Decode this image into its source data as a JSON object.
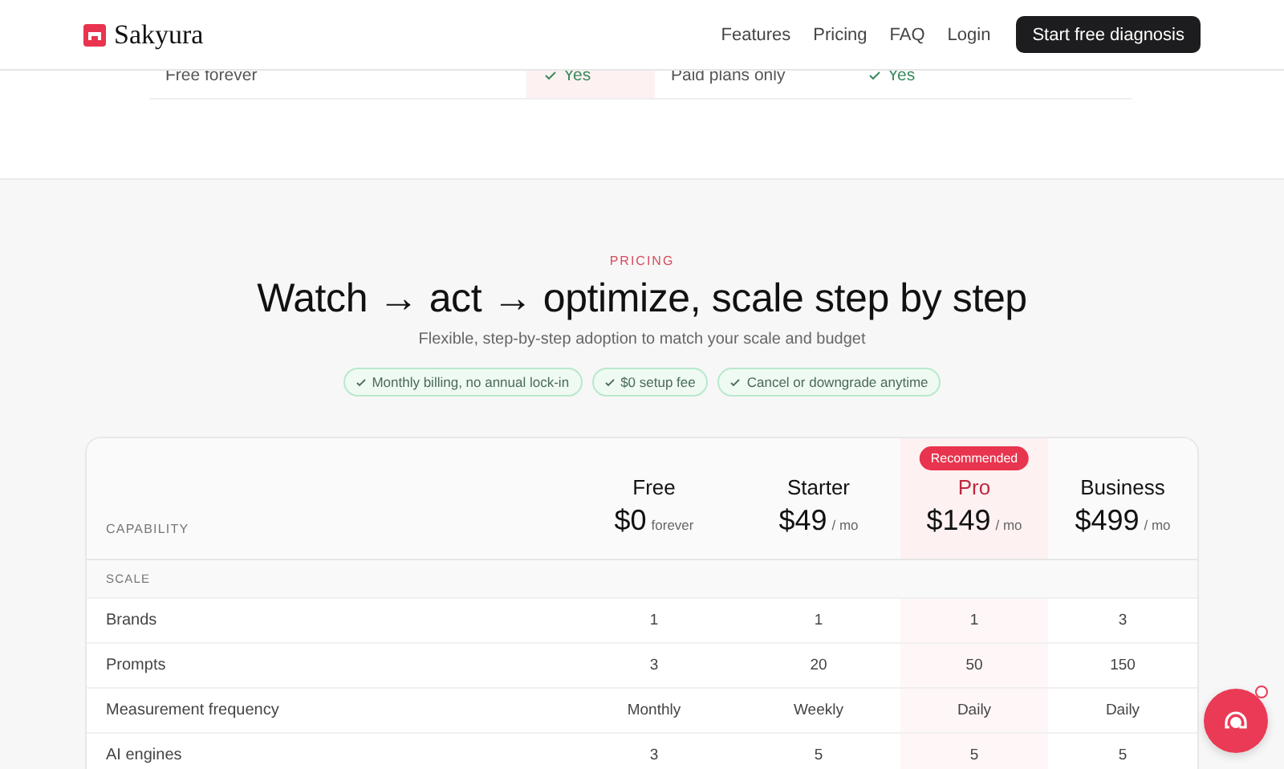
{
  "header": {
    "brand": "Sakyura",
    "nav": [
      "Features",
      "Pricing",
      "FAQ",
      "Login"
    ],
    "cta": "Start free diagnosis"
  },
  "comparison_row": {
    "cells": [
      {
        "text": "Free forever",
        "kind": "text",
        "highlighted": false
      },
      {
        "text": "Yes",
        "kind": "yes",
        "highlighted": true
      },
      {
        "text": "Paid plans only",
        "kind": "text",
        "highlighted": false
      },
      {
        "text": "Yes",
        "kind": "yes",
        "highlighted": false
      }
    ]
  },
  "pricing": {
    "eyebrow": "PRICING",
    "title": "Watch → act → optimize, scale step by step",
    "subtitle": "Flexible, step-by-step adoption to match your scale and budget",
    "chips": [
      "Monthly billing, no annual lock-in",
      "$0 setup fee",
      "Cancel or downgrade anytime"
    ],
    "table": {
      "capability_heading": "CAPABILITY",
      "plans": [
        {
          "name": "Free",
          "price": "$0",
          "period": "forever",
          "selected": false
        },
        {
          "name": "Starter",
          "price": "$49",
          "period": "/ mo",
          "selected": false
        },
        {
          "name": "Pro",
          "price": "$149",
          "period": "/ mo",
          "selected": true,
          "badge": "Recommended"
        },
        {
          "name": "Business",
          "price": "$499",
          "period": "/ mo",
          "selected": false
        }
      ],
      "group": "SCALE",
      "rows": [
        {
          "label": "Brands",
          "values": [
            "1",
            "1",
            "1",
            "3"
          ]
        },
        {
          "label": "Prompts",
          "values": [
            "3",
            "20",
            "50",
            "150"
          ]
        },
        {
          "label": "Measurement frequency",
          "values": [
            "Monthly",
            "Weekly",
            "Daily",
            "Daily"
          ]
        },
        {
          "label": "AI engines",
          "values": [
            "3",
            "5",
            "5",
            "5"
          ]
        }
      ]
    }
  },
  "chat": {
    "unread": true
  }
}
